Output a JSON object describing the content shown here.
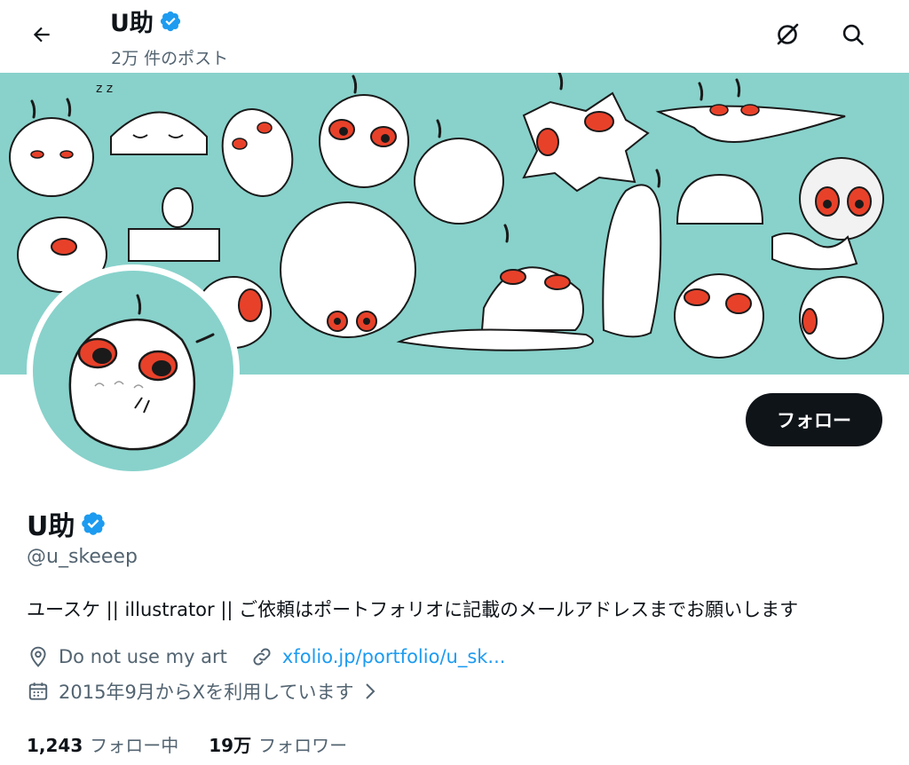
{
  "header": {
    "display_name": "U助",
    "post_count": "2万 件のポスト"
  },
  "profile": {
    "display_name": "U助",
    "handle": "@u_skeeep",
    "bio": "ユースケ || illustrator || ご依頼はポートフォリオに記載のメールアドレスまでお願いします",
    "location": "Do not use my art",
    "website": "xfolio.jp/portfolio/u_sk...",
    "joined": "2015年9月からXを利用しています",
    "following_count": "1,243",
    "following_label": "フォロー中",
    "followers_count": "19万",
    "followers_label": "フォロワー"
  },
  "actions": {
    "follow_label": "フォロー"
  },
  "icons": {
    "back": "arrow-left-icon",
    "grok": "grok-icon",
    "search": "search-icon",
    "verified": "verified-badge-icon",
    "location": "location-pin-icon",
    "link": "link-icon",
    "calendar": "calendar-icon",
    "chevron": "chevron-right-icon"
  },
  "colors": {
    "banner_bg": "#88d2cb",
    "accent": "#1d9bf0",
    "text": "#0f1419",
    "muted": "#536471",
    "eye_red": "#e8412a"
  }
}
